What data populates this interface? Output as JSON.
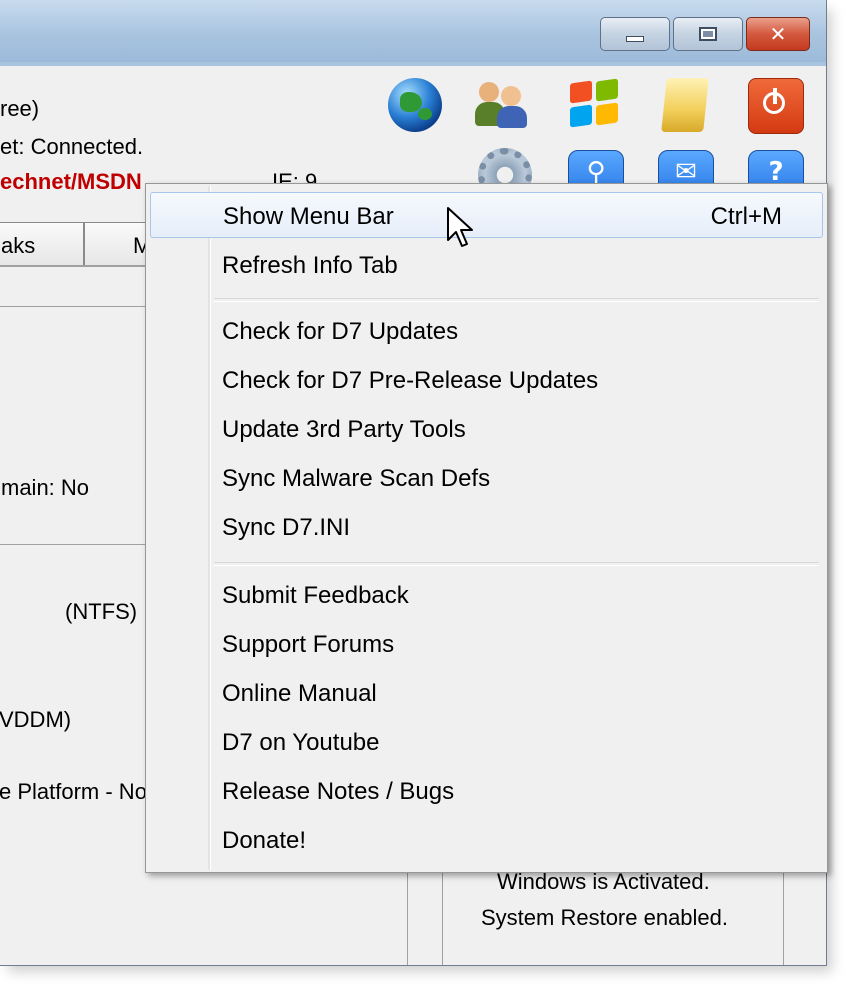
{
  "window": {
    "controls": {
      "minimize": "minimize-icon",
      "maximize": "maximize-icon",
      "close": "close-icon"
    }
  },
  "info": {
    "line1": "ree)",
    "line2": "et:  Connected.",
    "line3_red": "echnet/MSDN",
    "ie_label": "IE:  9"
  },
  "toolbar": {
    "icons": [
      "globe-icon",
      "users-icon",
      "windows-logo-icon",
      "folder-icon",
      "power-icon",
      "gear-icon",
      "search-icon",
      "mail-icon",
      "help-icon"
    ],
    "help_glyph": "?"
  },
  "tabs": [
    {
      "label": "aks"
    },
    {
      "label": "M"
    }
  ],
  "panels": {
    "domain": "main:  No",
    "fs": "(NTFS)",
    "wddm": "VDDM)",
    "platform": "e Platform - No",
    "activation": "Windows is Activated.",
    "restore": "System Restore enabled."
  },
  "context_menu": {
    "groups": [
      [
        {
          "label": "Show Menu Bar",
          "shortcut": "Ctrl+M",
          "highlighted": true
        },
        {
          "label": "Refresh Info Tab"
        }
      ],
      [
        {
          "label": "Check for D7 Updates"
        },
        {
          "label": "Check for D7 Pre-Release Updates"
        },
        {
          "label": "Update 3rd Party Tools"
        },
        {
          "label": "Sync Malware Scan Defs"
        },
        {
          "label": "Sync D7.INI"
        }
      ],
      [
        {
          "label": "Submit Feedback"
        },
        {
          "label": "Support Forums"
        },
        {
          "label": "Online Manual"
        },
        {
          "label": "D7 on Youtube"
        },
        {
          "label": "Release Notes / Bugs"
        },
        {
          "label": "Donate!"
        }
      ]
    ]
  },
  "colors": {
    "accent_red": "#c00000",
    "menu_highlight": "#e6eefa",
    "title_bar": "#a9c4df"
  }
}
